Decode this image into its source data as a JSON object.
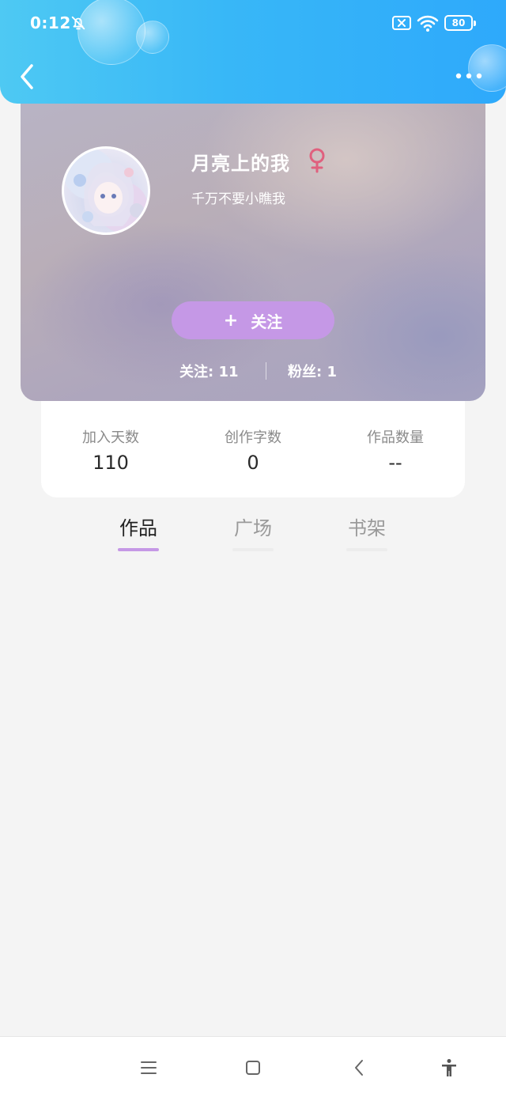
{
  "status_bar": {
    "time": "0:12",
    "battery": "80"
  },
  "profile": {
    "nickname": "月亮上的我",
    "gender_symbol": "♀",
    "signature": "千万不要小瞧我",
    "follow_button": {
      "plus": "+",
      "label": "关注"
    },
    "following": "关注: 11",
    "fans": "粉丝: 1"
  },
  "stats": [
    {
      "label": "加入天数",
      "value": "110"
    },
    {
      "label": "创作字数",
      "value": "0"
    },
    {
      "label": "作品数量",
      "value": "--"
    }
  ],
  "tabs": [
    {
      "label": "作品",
      "active": true
    },
    {
      "label": "广场",
      "active": false
    },
    {
      "label": "书架",
      "active": false
    }
  ],
  "colors": {
    "header": "#38b7f7",
    "accent": "#c598e6",
    "gender": "#e0607e"
  }
}
